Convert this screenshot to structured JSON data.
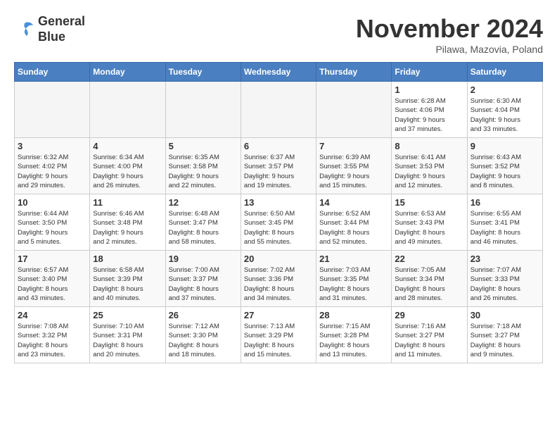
{
  "logo": {
    "line1": "General",
    "line2": "Blue"
  },
  "title": "November 2024",
  "location": "Pilawa, Mazovia, Poland",
  "days_of_week": [
    "Sunday",
    "Monday",
    "Tuesday",
    "Wednesday",
    "Thursday",
    "Friday",
    "Saturday"
  ],
  "weeks": [
    [
      {
        "day": "",
        "info": ""
      },
      {
        "day": "",
        "info": ""
      },
      {
        "day": "",
        "info": ""
      },
      {
        "day": "",
        "info": ""
      },
      {
        "day": "",
        "info": ""
      },
      {
        "day": "1",
        "info": "Sunrise: 6:28 AM\nSunset: 4:06 PM\nDaylight: 9 hours\nand 37 minutes."
      },
      {
        "day": "2",
        "info": "Sunrise: 6:30 AM\nSunset: 4:04 PM\nDaylight: 9 hours\nand 33 minutes."
      }
    ],
    [
      {
        "day": "3",
        "info": "Sunrise: 6:32 AM\nSunset: 4:02 PM\nDaylight: 9 hours\nand 29 minutes."
      },
      {
        "day": "4",
        "info": "Sunrise: 6:34 AM\nSunset: 4:00 PM\nDaylight: 9 hours\nand 26 minutes."
      },
      {
        "day": "5",
        "info": "Sunrise: 6:35 AM\nSunset: 3:58 PM\nDaylight: 9 hours\nand 22 minutes."
      },
      {
        "day": "6",
        "info": "Sunrise: 6:37 AM\nSunset: 3:57 PM\nDaylight: 9 hours\nand 19 minutes."
      },
      {
        "day": "7",
        "info": "Sunrise: 6:39 AM\nSunset: 3:55 PM\nDaylight: 9 hours\nand 15 minutes."
      },
      {
        "day": "8",
        "info": "Sunrise: 6:41 AM\nSunset: 3:53 PM\nDaylight: 9 hours\nand 12 minutes."
      },
      {
        "day": "9",
        "info": "Sunrise: 6:43 AM\nSunset: 3:52 PM\nDaylight: 9 hours\nand 8 minutes."
      }
    ],
    [
      {
        "day": "10",
        "info": "Sunrise: 6:44 AM\nSunset: 3:50 PM\nDaylight: 9 hours\nand 5 minutes."
      },
      {
        "day": "11",
        "info": "Sunrise: 6:46 AM\nSunset: 3:48 PM\nDaylight: 9 hours\nand 2 minutes."
      },
      {
        "day": "12",
        "info": "Sunrise: 6:48 AM\nSunset: 3:47 PM\nDaylight: 8 hours\nand 58 minutes."
      },
      {
        "day": "13",
        "info": "Sunrise: 6:50 AM\nSunset: 3:45 PM\nDaylight: 8 hours\nand 55 minutes."
      },
      {
        "day": "14",
        "info": "Sunrise: 6:52 AM\nSunset: 3:44 PM\nDaylight: 8 hours\nand 52 minutes."
      },
      {
        "day": "15",
        "info": "Sunrise: 6:53 AM\nSunset: 3:43 PM\nDaylight: 8 hours\nand 49 minutes."
      },
      {
        "day": "16",
        "info": "Sunrise: 6:55 AM\nSunset: 3:41 PM\nDaylight: 8 hours\nand 46 minutes."
      }
    ],
    [
      {
        "day": "17",
        "info": "Sunrise: 6:57 AM\nSunset: 3:40 PM\nDaylight: 8 hours\nand 43 minutes."
      },
      {
        "day": "18",
        "info": "Sunrise: 6:58 AM\nSunset: 3:39 PM\nDaylight: 8 hours\nand 40 minutes."
      },
      {
        "day": "19",
        "info": "Sunrise: 7:00 AM\nSunset: 3:37 PM\nDaylight: 8 hours\nand 37 minutes."
      },
      {
        "day": "20",
        "info": "Sunrise: 7:02 AM\nSunset: 3:36 PM\nDaylight: 8 hours\nand 34 minutes."
      },
      {
        "day": "21",
        "info": "Sunrise: 7:03 AM\nSunset: 3:35 PM\nDaylight: 8 hours\nand 31 minutes."
      },
      {
        "day": "22",
        "info": "Sunrise: 7:05 AM\nSunset: 3:34 PM\nDaylight: 8 hours\nand 28 minutes."
      },
      {
        "day": "23",
        "info": "Sunrise: 7:07 AM\nSunset: 3:33 PM\nDaylight: 8 hours\nand 26 minutes."
      }
    ],
    [
      {
        "day": "24",
        "info": "Sunrise: 7:08 AM\nSunset: 3:32 PM\nDaylight: 8 hours\nand 23 minutes."
      },
      {
        "day": "25",
        "info": "Sunrise: 7:10 AM\nSunset: 3:31 PM\nDaylight: 8 hours\nand 20 minutes."
      },
      {
        "day": "26",
        "info": "Sunrise: 7:12 AM\nSunset: 3:30 PM\nDaylight: 8 hours\nand 18 minutes."
      },
      {
        "day": "27",
        "info": "Sunrise: 7:13 AM\nSunset: 3:29 PM\nDaylight: 8 hours\nand 15 minutes."
      },
      {
        "day": "28",
        "info": "Sunrise: 7:15 AM\nSunset: 3:28 PM\nDaylight: 8 hours\nand 13 minutes."
      },
      {
        "day": "29",
        "info": "Sunrise: 7:16 AM\nSunset: 3:27 PM\nDaylight: 8 hours\nand 11 minutes."
      },
      {
        "day": "30",
        "info": "Sunrise: 7:18 AM\nSunset: 3:27 PM\nDaylight: 8 hours\nand 9 minutes."
      }
    ]
  ]
}
